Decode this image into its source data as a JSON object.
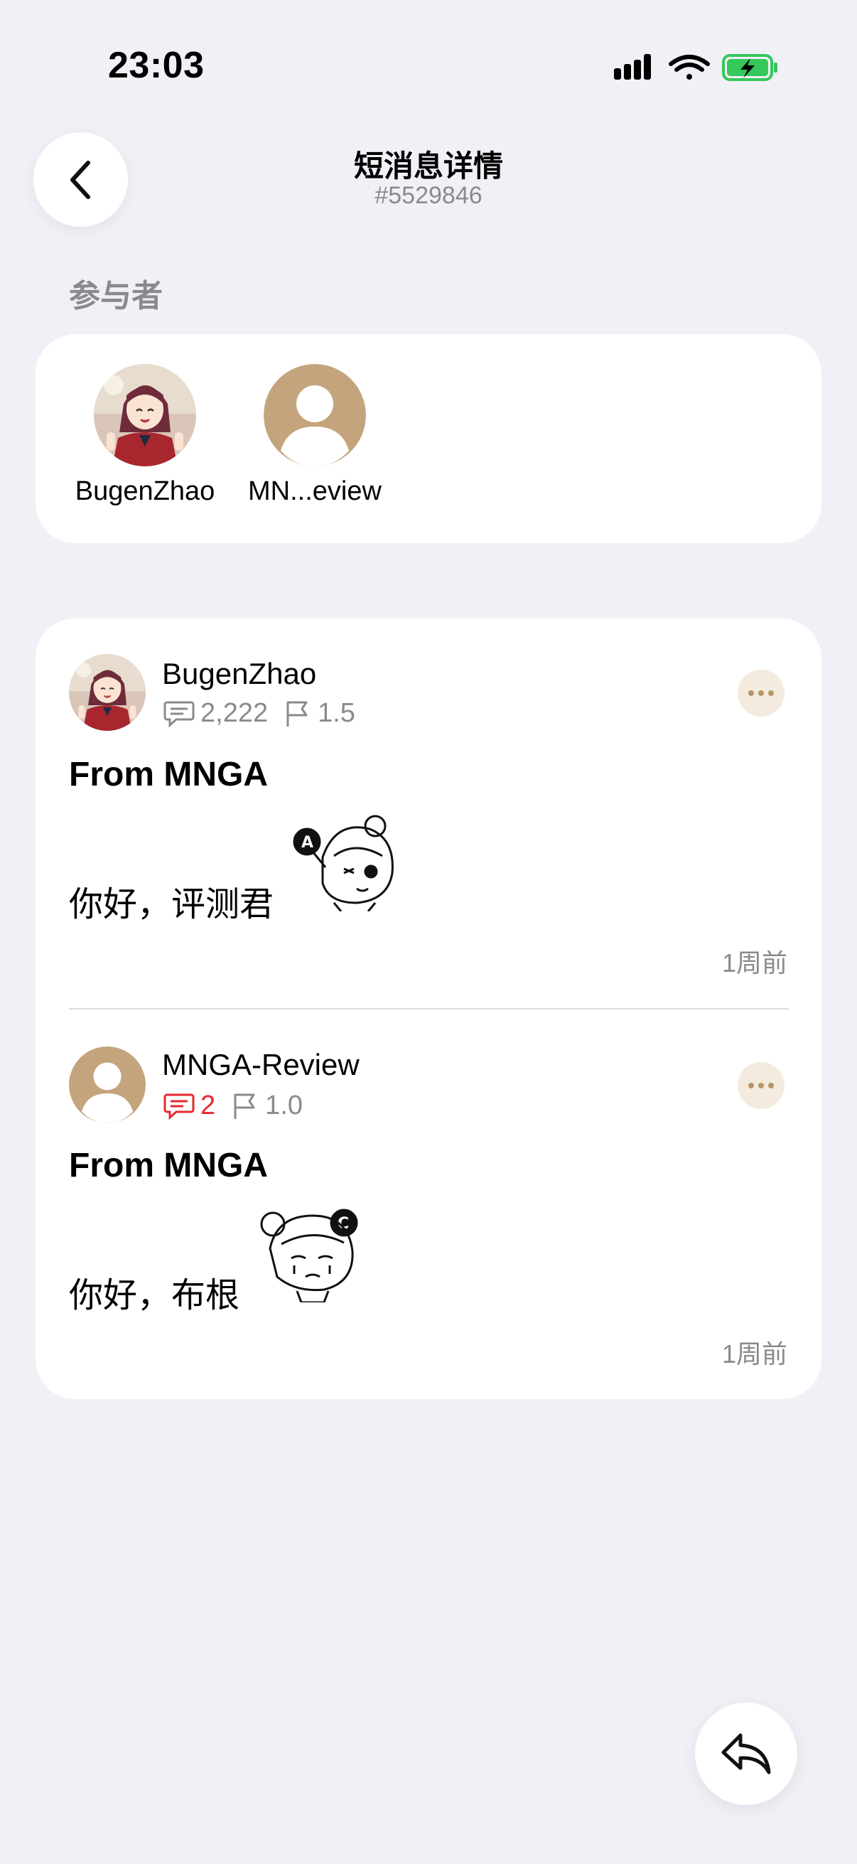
{
  "status_bar": {
    "time": "23:03"
  },
  "header": {
    "title": "短消息详情",
    "subtitle": "#5529846"
  },
  "participants_section": {
    "label": "参与者",
    "participants": [
      {
        "name": "BugenZhao",
        "avatar": "anime-girl-avatar"
      },
      {
        "name": "MN...eview",
        "avatar": "default-user-avatar"
      }
    ]
  },
  "messages": [
    {
      "author": "BugenZhao",
      "avatar": "anime-girl-avatar",
      "post_count": "2,222",
      "reputation": "1.5",
      "subject": "From MNGA",
      "body": "你好，评测君",
      "sticker": "ac-sticker-wink",
      "time": "1周前",
      "post_count_highlight": false
    },
    {
      "author": "MNGA-Review",
      "avatar": "default-user-avatar",
      "post_count": "2",
      "reputation": "1.0",
      "subject": "From MNGA",
      "body": "你好，布根",
      "sticker": "ac-sticker-cry",
      "time": "1周前",
      "post_count_highlight": true
    }
  ],
  "colors": {
    "background": "#f1f0f6",
    "accent": "#c4a47c",
    "highlight_red": "#e5292f",
    "muted_text": "#8a8a8e"
  }
}
